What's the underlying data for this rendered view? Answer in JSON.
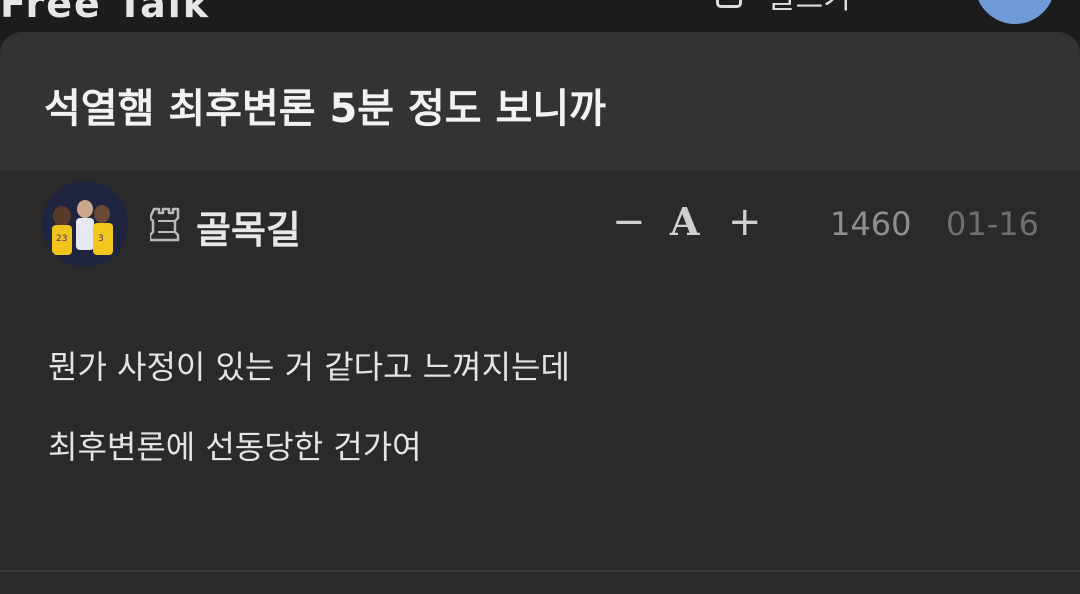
{
  "header": {
    "board_title": "Free Talk",
    "write_label": "글쓰기"
  },
  "post": {
    "title": "석열햄 최후변론 5분 정도 보니까",
    "author": "골목길",
    "views": "1460",
    "date": "01-16",
    "body": [
      "뭔가 사정이 있는 거 같다고 느껴지는데",
      "최후변론에 선동당한 건가여"
    ]
  },
  "font_controls": {
    "decrease": "−",
    "font": "A",
    "increase": "+"
  },
  "icons": {
    "level": "rook-level-icon",
    "write": "write-icon"
  },
  "colors": {
    "background": "#1f1f20",
    "card": "#2a2a2b",
    "title_bar": "#333334",
    "accent_avatar": "#6e9ad6"
  }
}
